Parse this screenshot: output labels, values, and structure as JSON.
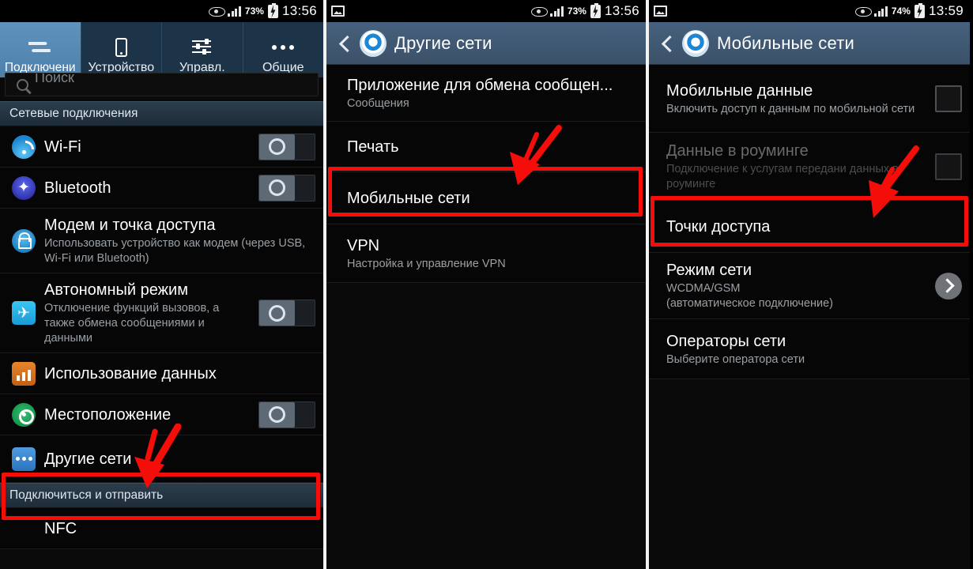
{
  "panels": [
    {
      "id": "connections",
      "statusbar": {
        "eye_icon": "eye-icon",
        "signal_icon": "signal-icon",
        "battery_percent": "73%",
        "battery_icon": "battery-charging-icon",
        "time": "13:56"
      },
      "tabs": [
        {
          "label": "Подключени",
          "icon": "sync-arrows-icon",
          "active": true
        },
        {
          "label": "Устройство",
          "icon": "phone-icon",
          "active": false
        },
        {
          "label": "Управл.",
          "icon": "sliders-icon",
          "active": false
        },
        {
          "label": "Общие",
          "icon": "three-dots-icon",
          "active": false
        }
      ],
      "search": {
        "placeholder": "Поиск",
        "icon": "search-icon"
      },
      "sections": [
        {
          "header": "Сетевые подключения",
          "rows": [
            {
              "title": "Wi-Fi",
              "sub": "",
              "icon": "wifi-icon",
              "control": "toggle"
            },
            {
              "title": "Bluetooth",
              "sub": "",
              "icon": "bluetooth-icon",
              "control": "toggle"
            },
            {
              "title": "Модем и точка доступа",
              "sub": "Использовать устройство как модем (через USB, Wi-Fi или Bluetooth)",
              "icon": "tethering-icon",
              "control": "none"
            },
            {
              "title": "Автономный режим",
              "sub": "Отключение функций вызовов, а также обмена сообщениями и данными",
              "icon": "airplane-icon",
              "control": "toggle"
            },
            {
              "title": "Использование данных",
              "sub": "",
              "icon": "data-usage-icon",
              "control": "none"
            },
            {
              "title": "Местоположение",
              "sub": "",
              "icon": "location-icon",
              "control": "toggle"
            },
            {
              "title": "Другие сети",
              "sub": "",
              "icon": "other-networks-icon",
              "control": "none",
              "highlighted": true
            }
          ]
        },
        {
          "header": "Подключиться и отправить",
          "rows": [
            {
              "title": "NFC",
              "sub": "",
              "icon": "none",
              "control": "none"
            }
          ]
        }
      ]
    },
    {
      "id": "other-networks",
      "statusbar": {
        "left_icon": "picture-icon",
        "eye_icon": "eye-icon",
        "signal_icon": "signal-icon",
        "battery_percent": "73%",
        "battery_icon": "battery-charging-icon",
        "time": "13:56"
      },
      "actionbar": {
        "back_icon": "back-chevron-icon",
        "app_icon": "settings-gear-icon",
        "title": "Другие сети"
      },
      "rows": [
        {
          "title": "Приложение для обмена сообщен...",
          "sub": "Сообщения",
          "control": "none"
        },
        {
          "title": "Печать",
          "sub": "",
          "control": "none"
        },
        {
          "title": "Мобильные сети",
          "sub": "",
          "control": "none",
          "highlighted": true
        },
        {
          "title": "VPN",
          "sub": "Настройка и управление VPN",
          "control": "none"
        }
      ]
    },
    {
      "id": "mobile-networks",
      "statusbar": {
        "left_icon": "picture-icon",
        "eye_icon": "eye-icon",
        "signal_icon": "signal-icon",
        "battery_percent": "74%",
        "battery_icon": "battery-charging-icon",
        "time": "13:59"
      },
      "actionbar": {
        "back_icon": "back-chevron-icon",
        "app_icon": "settings-gear-icon",
        "title": "Мобильные сети"
      },
      "rows": [
        {
          "title": "Мобильные данные",
          "sub": "Включить доступ к данным по мобильной сети",
          "control": "checkbox",
          "dim": false
        },
        {
          "title": "Данные в роуминге",
          "sub": "Подключение к услугам передани данных в роуминге",
          "control": "checkbox",
          "dim": true
        },
        {
          "title": "Точки доступа",
          "sub": "",
          "control": "none",
          "highlighted": true
        },
        {
          "title": "Режим сети",
          "sub": "WCDMA/GSM\n(автоматическое подключение)",
          "control": "chevron"
        },
        {
          "title": "Операторы сети",
          "sub": "Выберите оператора сети",
          "control": "none"
        }
      ]
    }
  ],
  "annotations": {
    "highlight_color": "#f50d09",
    "arrow_color": "#f50d09",
    "boxes": [
      {
        "panel": "connections",
        "target": "Другие сети"
      },
      {
        "panel": "other-networks",
        "target": "Мобильные сети"
      },
      {
        "panel": "mobile-networks",
        "target": "Точки доступа"
      }
    ]
  }
}
